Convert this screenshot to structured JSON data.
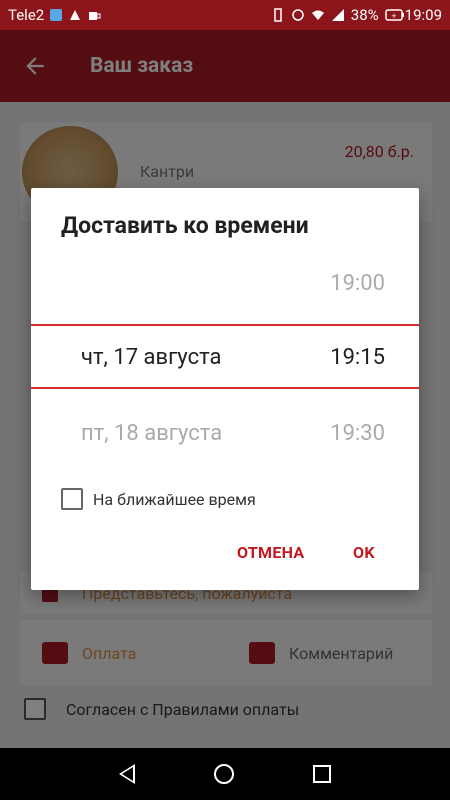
{
  "statusbar": {
    "carrier": "Tele2",
    "battery": "38%",
    "time": "19:09"
  },
  "appbar": {
    "title": "Ваш заказ",
    "back_icon": "arrow-left-icon"
  },
  "order": {
    "product_name": "Кантри",
    "product_price": "20,80 б.р."
  },
  "background_form": {
    "name_placeholder": "Представьтесь, пожалуйста",
    "payment_label": "Оплата",
    "comment_label": "Комментарий",
    "agree_label": "Согласен с Правилами оплаты"
  },
  "dialog": {
    "title": "Доставить ко времени",
    "rows": [
      {
        "date": "",
        "time": "19:00"
      },
      {
        "date": "чт, 17 августа",
        "time": "19:15"
      },
      {
        "date": "пт, 18 августа",
        "time": "19:30"
      }
    ],
    "asap_label": "На ближайшее время",
    "cancel_label": "ОТМЕНА",
    "ok_label": "OK"
  },
  "colors": {
    "primary": "#a81a22",
    "accent": "#c2181f"
  }
}
